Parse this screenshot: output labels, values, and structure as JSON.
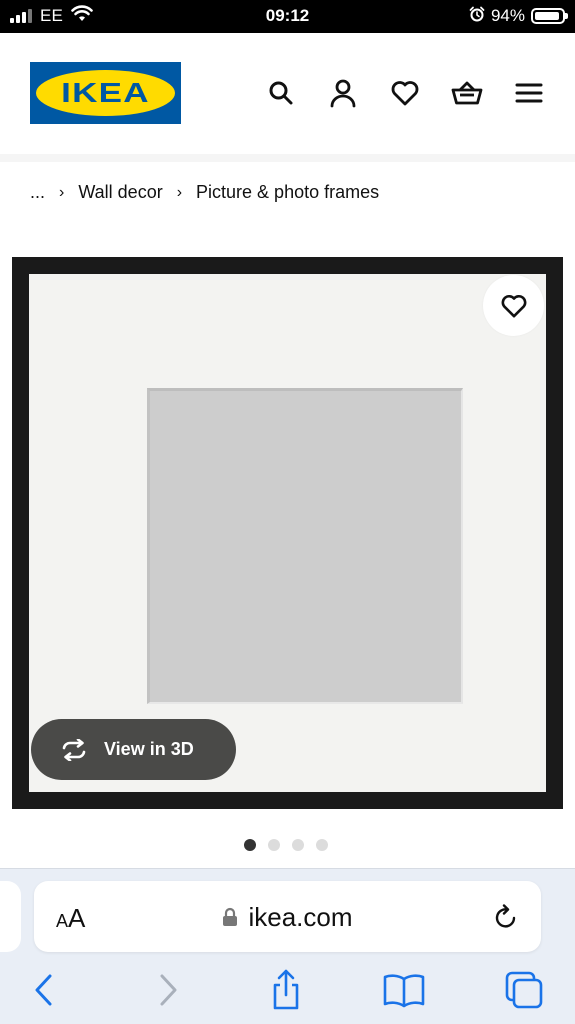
{
  "status_bar": {
    "carrier": "EE",
    "time": "09:12",
    "battery_percent": "94%",
    "battery_level": 0.94,
    "icons": [
      "signal-icon",
      "wifi-icon",
      "alarm-icon",
      "battery-icon"
    ]
  },
  "header": {
    "logo_text": "IKEA",
    "brand_colors": {
      "blue": "#0058a3",
      "yellow": "#ffdb00"
    },
    "icons": [
      "search-icon",
      "profile-icon",
      "heart-icon",
      "basket-icon",
      "menu-icon"
    ]
  },
  "breadcrumb": {
    "ellipsis": "...",
    "separator": "›",
    "items": [
      "Wall decor",
      "Picture & photo frames"
    ]
  },
  "product": {
    "view_3d_label": "View in 3D",
    "carousel": {
      "count": 4,
      "active_index": 0
    }
  },
  "browser": {
    "text_size_label_small": "A",
    "text_size_label_large": "A",
    "url": "ikea.com",
    "toolbar_icons": [
      "back-icon",
      "forward-icon",
      "share-icon",
      "bookmarks-icon",
      "tabs-icon"
    ]
  }
}
